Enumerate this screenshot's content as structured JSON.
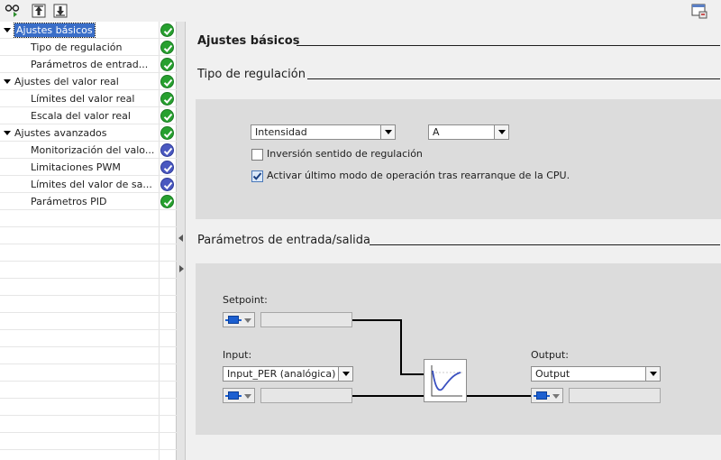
{
  "tree": {
    "items": [
      {
        "label": "Ajustes básicos",
        "level": 0,
        "expanded": true,
        "selected": true,
        "status": "ok"
      },
      {
        "label": "Tipo de regulación",
        "level": 1,
        "status": "ok"
      },
      {
        "label": "Parámetros de entrad...",
        "level": 1,
        "status": "ok"
      },
      {
        "label": "Ajustes del valor real",
        "level": 0,
        "expanded": true,
        "status": "ok"
      },
      {
        "label": "Límites del valor real",
        "level": 1,
        "status": "ok"
      },
      {
        "label": "Escala del valor real",
        "level": 1,
        "status": "ok"
      },
      {
        "label": "Ajustes avanzados",
        "level": 0,
        "expanded": true,
        "status": "ok"
      },
      {
        "label": "Monitorización del valo...",
        "level": 1,
        "status": "info"
      },
      {
        "label": "Limitaciones PWM",
        "level": 1,
        "status": "info"
      },
      {
        "label": "Límites del valor de sa...",
        "level": 1,
        "status": "info"
      },
      {
        "label": "Parámetros PID",
        "level": 1,
        "status": "ok"
      }
    ],
    "empty_rows": 14
  },
  "content": {
    "title": "Ajustes básicos",
    "control_type": {
      "title": "Tipo de regulación",
      "quantity_value": "Intensidad",
      "unit_value": "A",
      "invert_label": "Inversión sentido de regulación",
      "invert_checked": false,
      "restart_label": "Activar último modo de operación tras rearranque de la CPU.",
      "restart_checked": true
    },
    "io_params": {
      "title": "Parámetros de entrada/salida",
      "setpoint_label": "Setpoint:",
      "input_label": "Input:",
      "input_value": "Input_PER (analógica)",
      "output_label": "Output:",
      "output_value": "Output"
    }
  },
  "colors": {
    "ok": "#27a02f",
    "info": "#4a58c0",
    "selection": "#3a6ec8",
    "tag_blue": "#1c5fd0"
  }
}
